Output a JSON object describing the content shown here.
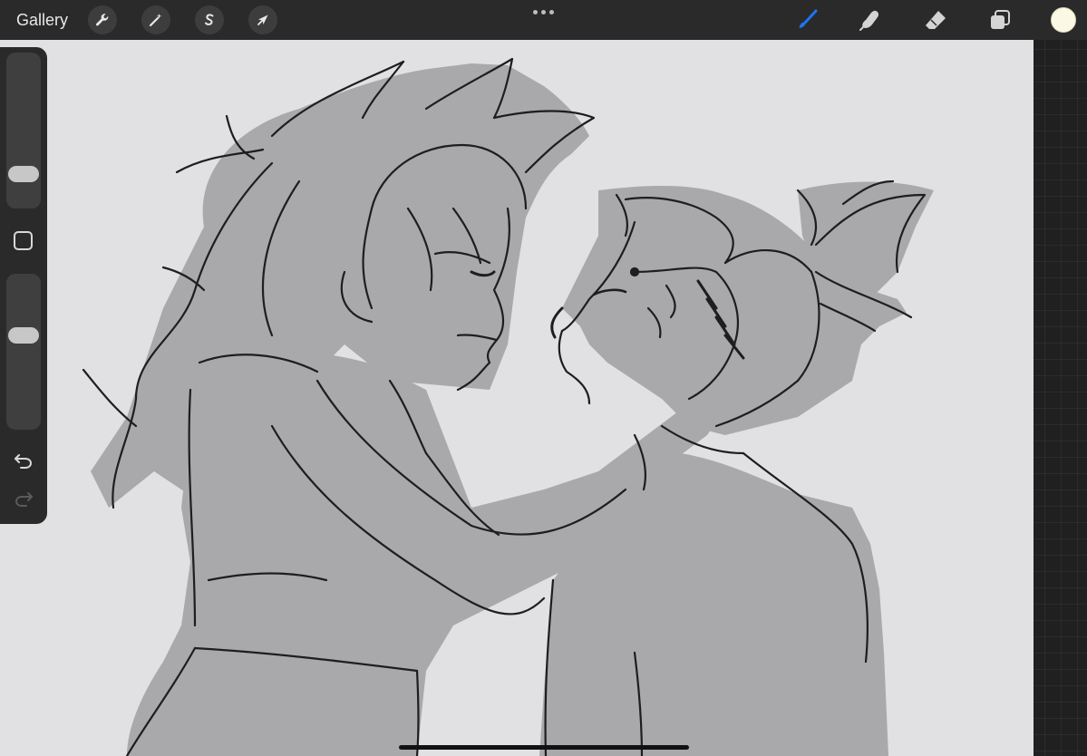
{
  "topbar": {
    "gallery_label": "Gallery",
    "left_tools": [
      {
        "name": "actions",
        "icon": "wrench-icon"
      },
      {
        "name": "adjustments",
        "icon": "magic-wand-icon"
      },
      {
        "name": "selection",
        "icon": "selection-s-icon"
      },
      {
        "name": "transform",
        "icon": "arrow-cursor-icon"
      }
    ],
    "right_tools": [
      {
        "name": "brush",
        "icon": "brush-icon",
        "active": true
      },
      {
        "name": "smudge",
        "icon": "smudge-finger-icon",
        "active": false
      },
      {
        "name": "eraser",
        "icon": "eraser-icon",
        "active": false
      },
      {
        "name": "layers",
        "icon": "layers-icon",
        "active": false
      }
    ],
    "active_tool_color": "#1e74f0",
    "current_color": "#fbf8e3"
  },
  "sidebar": {
    "brush_size_level": 0.18,
    "brush_opacity_level": 0.62,
    "modify_button_icon": "square-icon",
    "undo_icon": "undo-arrow-icon",
    "redo_icon": "redo-arrow-icon"
  },
  "canvas": {
    "background_color": "#e1e0e2",
    "content": "sketch-of-two-figures"
  }
}
